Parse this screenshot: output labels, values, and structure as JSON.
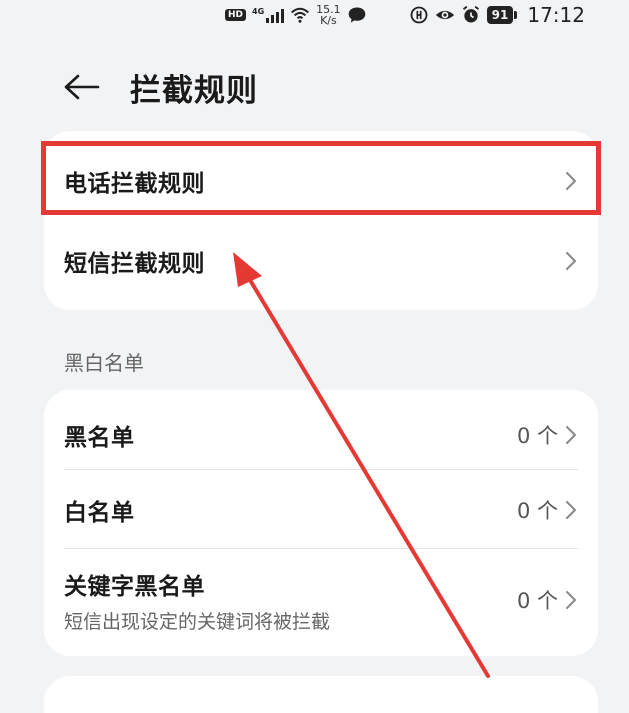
{
  "status_bar": {
    "hd": "HD",
    "network": "4G",
    "speed_value": "15.1",
    "speed_unit": "K/s",
    "battery": "91",
    "time": "17:12"
  },
  "header": {
    "title": "拦截规则"
  },
  "rules_card": {
    "items": [
      {
        "label": "电话拦截规则"
      },
      {
        "label": "短信拦截规则"
      }
    ]
  },
  "blackwhite_section": {
    "label": "黑白名单",
    "items": [
      {
        "label": "黑名单",
        "count": "0 个"
      },
      {
        "label": "白名单",
        "count": "0 个"
      },
      {
        "label": "关键字黑名单",
        "subtitle": "短信出现设定的关键词将被拦截",
        "count": "0 个"
      }
    ]
  },
  "colors": {
    "background": "#f1f3f5",
    "card": "#ffffff",
    "annotation_red": "#e53935"
  }
}
